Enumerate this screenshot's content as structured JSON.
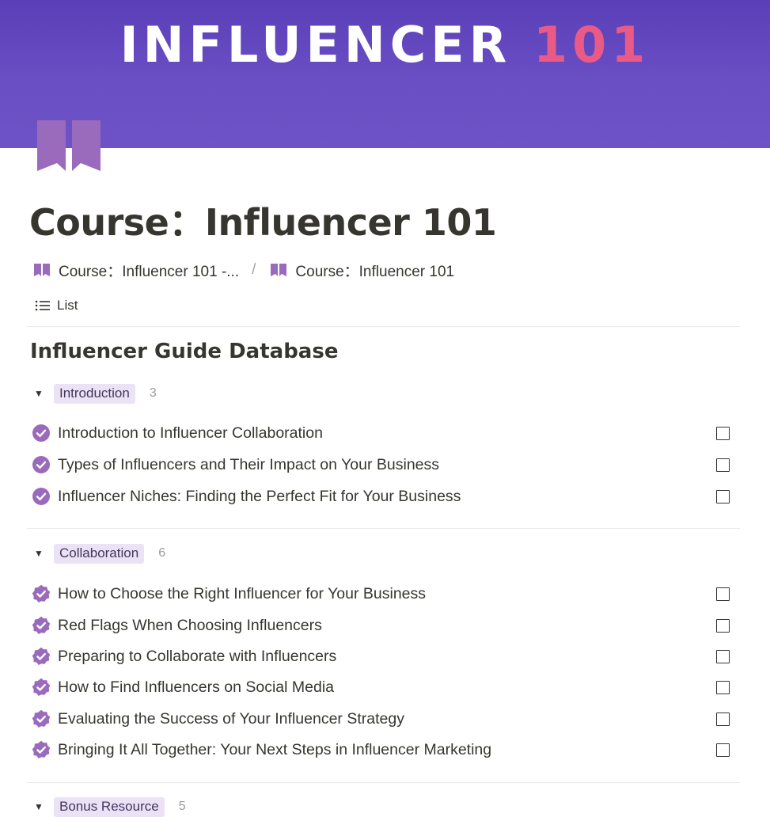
{
  "banner": {
    "title_main": "INFLUENCER",
    "title_accent": "101"
  },
  "page": {
    "icon": "open-book-icon",
    "title": "Course：Influencer 101"
  },
  "breadcrumb": [
    {
      "icon": "open-book-icon",
      "label": "Course：Influencer 101 -..."
    },
    {
      "icon": "open-book-icon",
      "label": "Course：Influencer 101"
    }
  ],
  "breadcrumb_separator": "/",
  "view": {
    "icon": "list-icon",
    "label": "List"
  },
  "database": {
    "title": "Influencer Guide Database"
  },
  "groups": [
    {
      "label": "Introduction",
      "count": "3",
      "row_icon": "check-circle-icon",
      "items": [
        "Introduction to Influencer Collaboration",
        "Types of Influencers and Their Impact on Your Business",
        "Influencer Niches: Finding the Perfect Fit for Your Business"
      ]
    },
    {
      "label": "Collaboration",
      "count": "6",
      "row_icon": "verified-badge-icon",
      "items": [
        "How to Choose the Right Influencer for Your Business",
        "Red Flags When Choosing Influencers",
        "Preparing to Collaborate with Influencers",
        "How to Find Influencers on Social Media",
        "Evaluating the Success of Your Influencer Strategy",
        "Bringing It All Together: Your Next Steps in Influencer Marketing"
      ]
    },
    {
      "label": "Bonus Resource",
      "count": "5"
    }
  ],
  "colors": {
    "banner": "#6a4ec4",
    "banner_accent": "#e95a86",
    "icon_purple": "#9a6bbd",
    "tag_background": "#ebe3f5"
  }
}
